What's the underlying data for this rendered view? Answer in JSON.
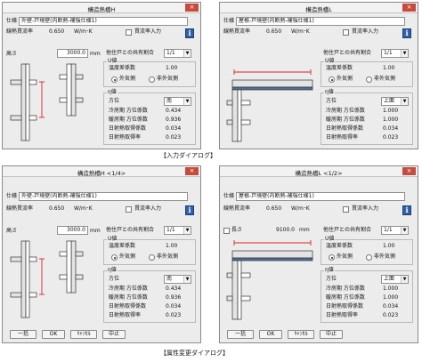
{
  "captions": {
    "input": "【入力ダイアログ】",
    "attr": "【属性変更ダイアログ】"
  },
  "colors": {
    "beam": "#4d6e99",
    "dim": "#e0212b"
  },
  "d1": {
    "title": "構造熱橋H",
    "close": "×",
    "spec_label": "仕様",
    "spec_value": "外壁-戸境壁(内断熱-補強仕様1)",
    "lin_label": "線熱貫流率",
    "lin_value": "0.650",
    "lin_unit": "W/m･K",
    "penetration_label": "貫流率入力",
    "info": "i",
    "height_label": "高さ",
    "height_value": "3000.0",
    "height_unit": "mm",
    "share_label": "他住戸との共有割合",
    "share_value": "1/1",
    "u_group": "U値",
    "temp_label": "温度差係数",
    "temp_value": "1.00",
    "outside": "外気側",
    "non_outside": "非外気側",
    "eta_group": "η値",
    "dir_label": "方位",
    "dir_value": "南",
    "c_orient_label": "冷房期 方位係数",
    "c_orient_value": "0.434",
    "h_orient_label": "暖房期 方位係数",
    "h_orient_value": "0.936",
    "shade_label": "日射熱取得係数",
    "shade_value": "0.034",
    "solar_label": "日射熱取得率",
    "solar_value": "0.023"
  },
  "d2": {
    "title": "構造熱橋L",
    "close": "×",
    "spec_label": "仕様",
    "spec_value": "屋根-戸境壁(内断熱-補強仕様1)",
    "lin_label": "線熱貫流率",
    "lin_value": "0.650",
    "lin_unit": "W/m･K",
    "penetration_label": "貫流率入力",
    "info": "i",
    "share_label": "他住戸との共有割合",
    "share_value": "1/1",
    "u_group": "U値",
    "temp_label": "温度差係数",
    "temp_value": "1.00",
    "outside": "外気側",
    "non_outside": "非外気側",
    "eta_group": "η値",
    "dir_label": "方位",
    "dir_value": "上面",
    "c_orient_label": "冷房期 方位係数",
    "c_orient_value": "1.000",
    "h_orient_label": "暖房期 方位係数",
    "h_orient_value": "1.000",
    "shade_label": "日射熱取得係数",
    "shade_value": "0.034",
    "solar_label": "日射熱取得率",
    "solar_value": "0.023"
  },
  "d3": {
    "title": "構造熱橋H <1/4>",
    "close": "×",
    "spec_label": "仕様",
    "spec_value": "外壁-戸境壁(内断熱-補強仕様1)",
    "lin_label": "線熱貫流率",
    "lin_value": "0.650",
    "lin_unit": "W/m･K",
    "penetration_label": "貫流率入力",
    "info": "i",
    "height_label": "高さ",
    "height_value": "3000.0",
    "height_unit": "mm",
    "share_label": "他住戸との共有割合",
    "share_value": "1/1",
    "u_group": "U値",
    "temp_label": "温度差係数",
    "temp_value": "1.00",
    "outside": "外気側",
    "non_outside": "非外気側",
    "eta_group": "η値",
    "dir_label": "方位",
    "dir_value": "南",
    "c_orient_label": "冷房期 方位係数",
    "c_orient_value": "0.434",
    "h_orient_label": "暖房期 方位係数",
    "h_orient_value": "0.936",
    "shade_label": "日射熱取得係数",
    "shade_value": "0.034",
    "solar_label": "日射熱取得率",
    "solar_value": "0.023",
    "btn_all": "一括",
    "btn_ok": "OK",
    "btn_cancel": "ｷｬﾝｾﾙ",
    "btn_stop": "中止"
  },
  "d4": {
    "title": "構造熱橋L <1/2>",
    "close": "×",
    "spec_label": "仕様",
    "spec_value": "屋根-戸境壁(内断熱-補強仕様1)",
    "lin_label": "線熱貫流率",
    "lin_value": "0.650",
    "lin_unit": "W/m･K",
    "penetration_label": "貫流率入力",
    "info": "i",
    "length_label": "長さ",
    "length_value": "9100.0",
    "length_unit": "mm",
    "share_label": "他住戸との共有割合",
    "share_value": "1/1",
    "u_group": "U値",
    "temp_label": "温度差係数",
    "temp_value": "1.00",
    "outside": "外気側",
    "non_outside": "非外気側",
    "eta_group": "η値",
    "dir_label": "方位",
    "dir_value": "上面",
    "c_orient_label": "冷房期 方位係数",
    "c_orient_value": "1.000",
    "h_orient_label": "暖房期 方位係数",
    "h_orient_value": "1.000",
    "shade_label": "日射熱取得係数",
    "shade_value": "0.034",
    "solar_label": "日射熱取得率",
    "solar_value": "0.023",
    "btn_all": "一括",
    "btn_ok": "OK",
    "btn_cancel": "ｷｬﾝｾﾙ",
    "btn_stop": "中止"
  }
}
